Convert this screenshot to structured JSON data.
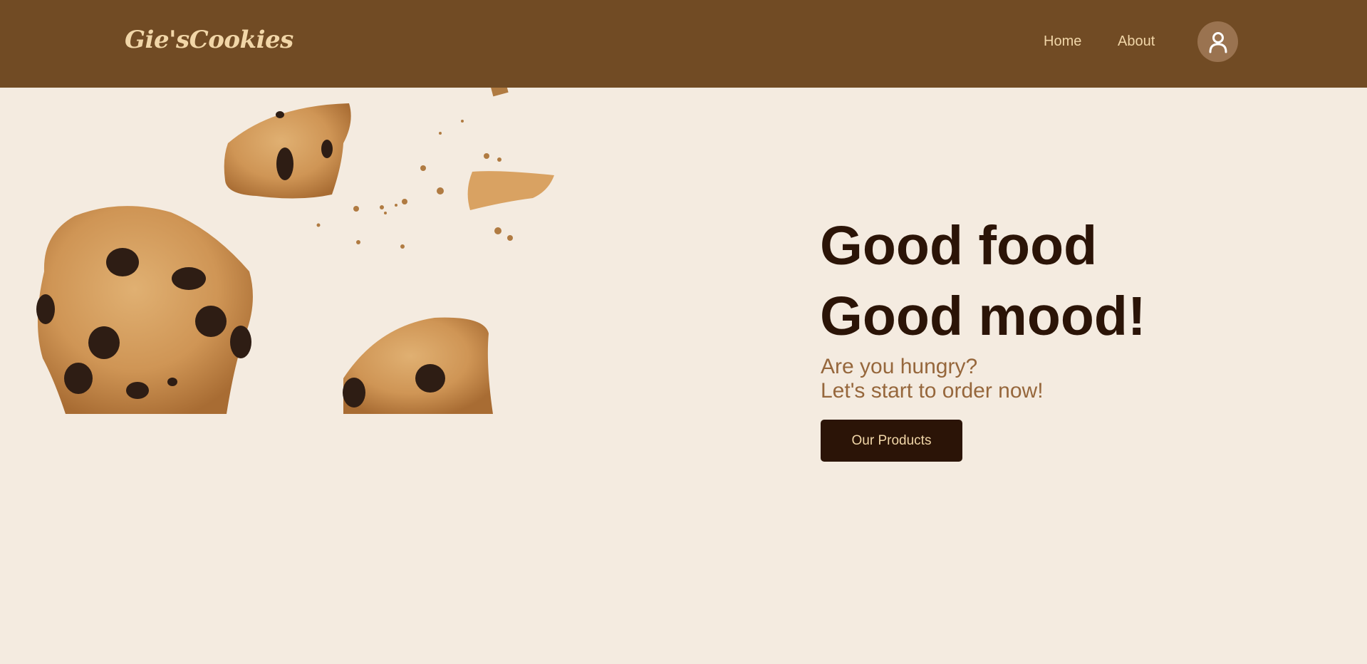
{
  "header": {
    "brand": "Gie'sCookies",
    "nav": [
      {
        "label": "Home"
      },
      {
        "label": "About"
      }
    ],
    "profile_icon": "user-icon"
  },
  "hero": {
    "headline_line1": "Good food",
    "headline_line2": "Good mood!",
    "subtitle_line1": "Are you hungry?",
    "subtitle_line2": "Let's start to order now!",
    "cta_label": "Our Products",
    "image": "broken-cookies-illustration"
  },
  "colors": {
    "nav_bg": "#714b24",
    "page_bg": "#f4ebe0",
    "accent_text": "#f1d6a8",
    "headline": "#2b1407",
    "subtitle": "#96673c",
    "button_bg": "#2b1407"
  }
}
